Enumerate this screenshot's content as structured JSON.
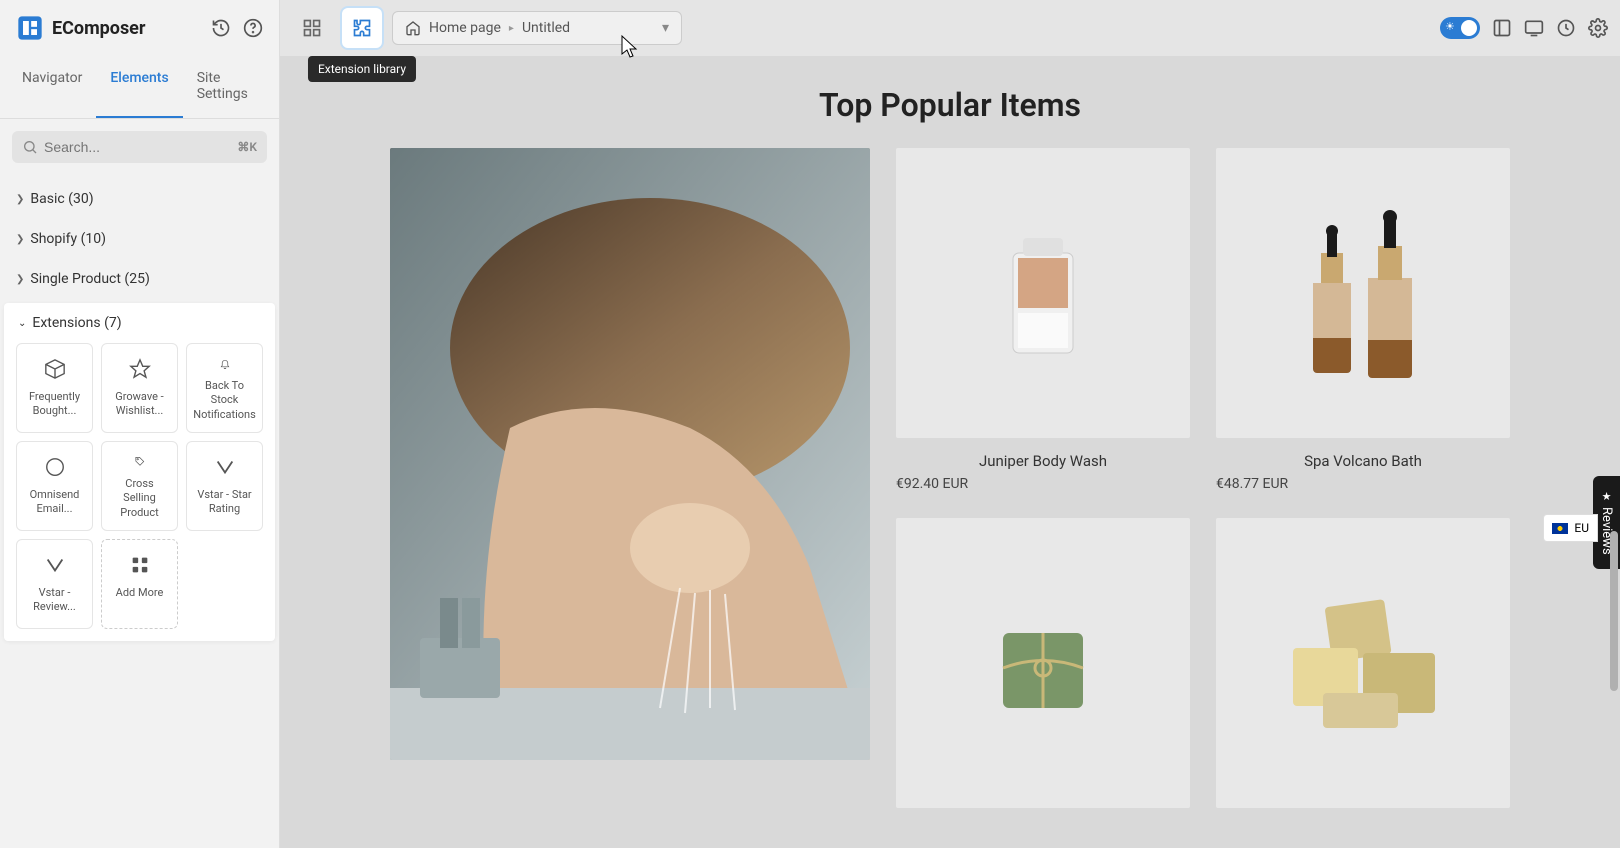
{
  "app_name": "EComposer",
  "tabs": {
    "navigator": "Navigator",
    "elements": "Elements",
    "site_settings": "Site Settings"
  },
  "search": {
    "placeholder": "Search...",
    "shortcut": "⌘K"
  },
  "categories": [
    {
      "label": "Basic (30)"
    },
    {
      "label": "Shopify (10)"
    },
    {
      "label": "Single Product (25)"
    }
  ],
  "extensions": {
    "header": "Extensions (7)",
    "items": [
      {
        "label": "Frequently Bought..."
      },
      {
        "label": "Growave - Wishlist..."
      },
      {
        "label": "Back To Stock Notifications"
      },
      {
        "label": "Omnisend Email..."
      },
      {
        "label": "Cross Selling Product"
      },
      {
        "label": "Vstar - Star Rating"
      },
      {
        "label": "Vstar - Review..."
      },
      {
        "label": "Add More"
      }
    ]
  },
  "tooltip": "Extension library",
  "breadcrumb": {
    "root": "Home page",
    "page": "Untitled"
  },
  "canvas": {
    "title": "Top Popular Items",
    "products": [
      {
        "name": "Juniper Body Wash",
        "price": "€92.40 EUR"
      },
      {
        "name": "Spa Volcano Bath",
        "price": "€48.77 EUR"
      },
      {
        "name": "",
        "price": ""
      },
      {
        "name": "",
        "price": ""
      }
    ]
  },
  "reviews_label": "Reviews",
  "currency_label": "EU"
}
